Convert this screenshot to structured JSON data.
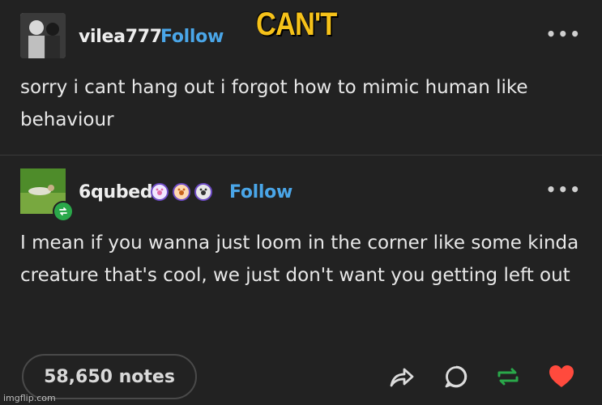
{
  "meme_caption": "CAN'T",
  "post": {
    "author": "vilea777",
    "follow_label": "Follow",
    "more_label": "•••",
    "text": "sorry i cant hang out i forgot how to mimic human like behaviour"
  },
  "reply": {
    "author": "6qubed",
    "follow_label": "Follow",
    "more_label": "•••",
    "text": "I mean if you wanna just loom in the corner like some kinda creature that's cool, we just don't want you getting left out"
  },
  "footer": {
    "notes": "58,650 notes"
  },
  "watermark": "imgflip.com",
  "colors": {
    "background": "#222222",
    "follow": "#4aa6e8",
    "reblog": "#2aa84a",
    "like": "#ff4a3d",
    "caption": "#f6c21a"
  },
  "icons": [
    "share-icon",
    "reply-icon",
    "reblog-icon",
    "heart-icon"
  ]
}
